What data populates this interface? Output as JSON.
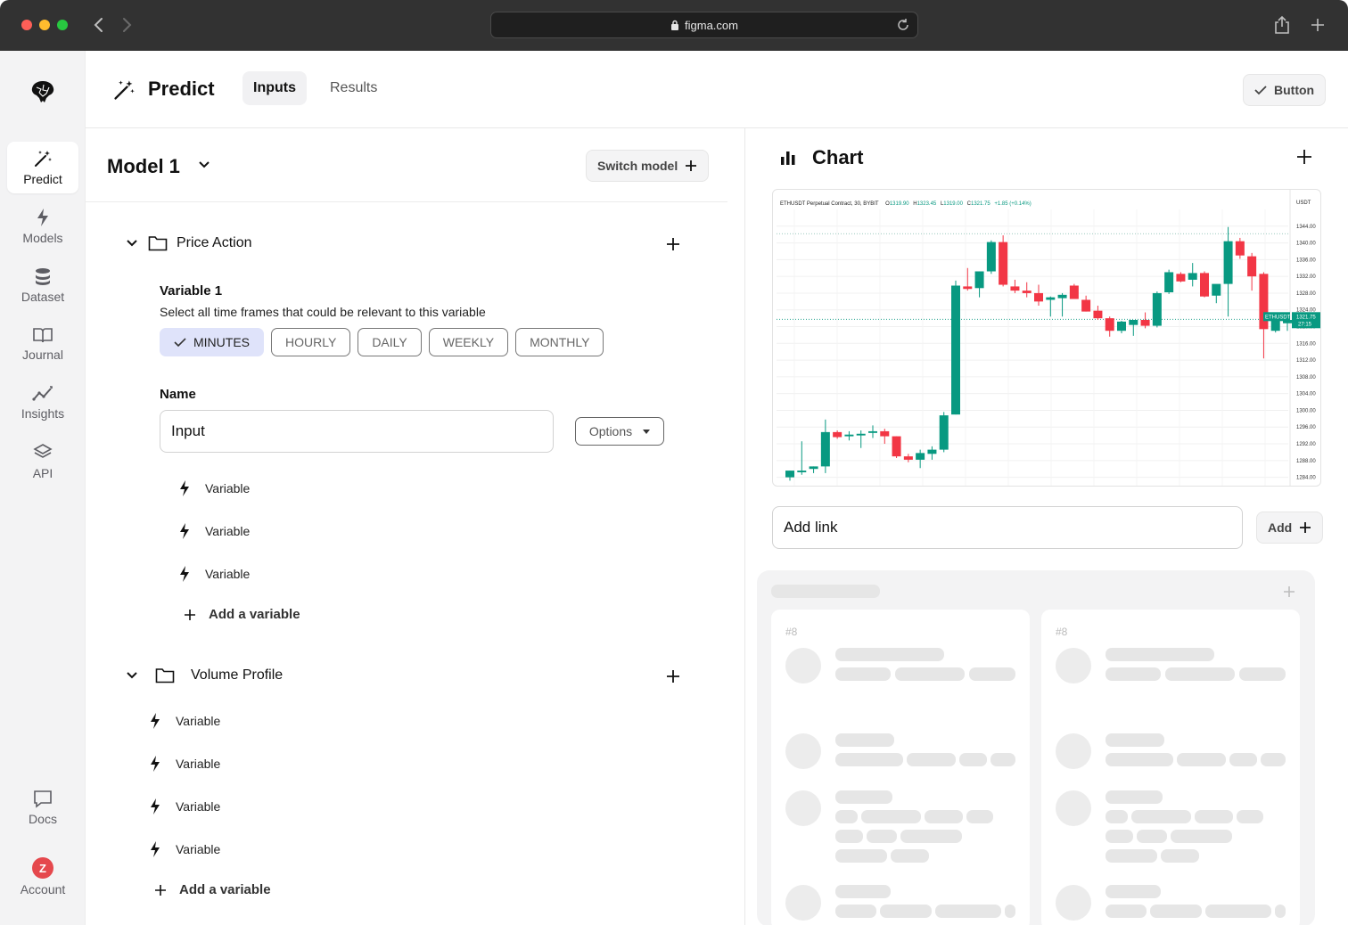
{
  "browser": {
    "url": "figma.com"
  },
  "sidebar": {
    "items": [
      {
        "label": "Predict",
        "icon": "magic-wand-icon",
        "active": true
      },
      {
        "label": "Models",
        "icon": "bolt-icon"
      },
      {
        "label": "Dataset",
        "icon": "database-icon"
      },
      {
        "label": "Journal",
        "icon": "book-icon"
      },
      {
        "label": "Insights",
        "icon": "trend-icon"
      },
      {
        "label": "API",
        "icon": "layers-icon"
      }
    ],
    "bottom": [
      {
        "label": "Docs",
        "icon": "chat-icon"
      },
      {
        "label": "Account",
        "avatar": "Z"
      }
    ]
  },
  "header": {
    "title": "Predict",
    "tabs": [
      {
        "label": "Inputs",
        "active": true
      },
      {
        "label": "Results"
      }
    ],
    "button": "Button"
  },
  "model": {
    "title": "Model 1",
    "switch_label": "Switch model",
    "sections": [
      {
        "title": "Price Action",
        "variable_title": "Variable 1",
        "variable_desc": "Select all time frames that could be relevant to this variable",
        "timeframes": [
          {
            "label": "MINUTES",
            "selected": true
          },
          {
            "label": "HOURLY"
          },
          {
            "label": "DAILY"
          },
          {
            "label": "WEEKLY"
          },
          {
            "label": "MONTHLY"
          }
        ],
        "name_label": "Name",
        "name_value": "Input",
        "options_label": "Options",
        "variables": [
          "Variable",
          "Variable",
          "Variable"
        ],
        "add_label": "Add a variable"
      },
      {
        "title": "Volume Profile",
        "variables": [
          "Variable",
          "Variable",
          "Variable",
          "Variable"
        ],
        "add_label": "Add a variable"
      }
    ]
  },
  "chart_panel": {
    "title": "Chart",
    "link_placeholder": "Add link",
    "add_label": "Add",
    "cards": [
      {
        "number": "#8"
      },
      {
        "number": "#8"
      }
    ]
  },
  "chart_data": {
    "type": "candlestick",
    "title": "ETHUSDT Perpetual Contract, 30, BYBIT",
    "ohlc_readout": {
      "O": "1319.90",
      "H": "1323.45",
      "L": "1319.00",
      "C": "1321.75",
      "change": "+1.85 (+0.14%)"
    },
    "currency": "USDT",
    "ylim": [
      1282,
      1348
    ],
    "y_ticks": [
      1344,
      1340,
      1336,
      1332,
      1328,
      1324,
      1320,
      1316,
      1312,
      1308,
      1304,
      1300,
      1296,
      1292,
      1288,
      1284
    ],
    "price_tag": {
      "symbol": "ETHUSDT",
      "price": "1321.75",
      "time": "27:15"
    },
    "colors": {
      "up": "#089981",
      "down": "#f23645"
    },
    "candles": [
      {
        "o": 1284.0,
        "h": 1285.6,
        "l": 1283.2,
        "c": 1285.6
      },
      {
        "o": 1285.2,
        "h": 1292.6,
        "l": 1284.6,
        "c": 1285.6
      },
      {
        "o": 1286.0,
        "h": 1286.6,
        "l": 1285.0,
        "c": 1286.6
      },
      {
        "o": 1286.6,
        "h": 1297.8,
        "l": 1285.0,
        "c": 1294.8
      },
      {
        "o": 1294.8,
        "h": 1295.2,
        "l": 1293.2,
        "c": 1293.6
      },
      {
        "o": 1293.8,
        "h": 1295.0,
        "l": 1292.8,
        "c": 1294.2
      },
      {
        "o": 1294.0,
        "h": 1295.2,
        "l": 1291.0,
        "c": 1294.4
      },
      {
        "o": 1294.6,
        "h": 1296.4,
        "l": 1293.4,
        "c": 1295.0
      },
      {
        "o": 1295.0,
        "h": 1295.6,
        "l": 1292.0,
        "c": 1293.8
      },
      {
        "o": 1293.8,
        "h": 1293.8,
        "l": 1288.6,
        "c": 1289.0
      },
      {
        "o": 1289.0,
        "h": 1289.6,
        "l": 1287.6,
        "c": 1288.2
      },
      {
        "o": 1288.2,
        "h": 1290.6,
        "l": 1286.2,
        "c": 1289.8
      },
      {
        "o": 1289.6,
        "h": 1291.4,
        "l": 1288.2,
        "c": 1290.6
      },
      {
        "o": 1290.6,
        "h": 1299.6,
        "l": 1290.0,
        "c": 1298.8
      },
      {
        "o": 1299.0,
        "h": 1331.0,
        "l": 1299.0,
        "c": 1329.8
      },
      {
        "o": 1329.6,
        "h": 1334.0,
        "l": 1328.6,
        "c": 1329.0
      },
      {
        "o": 1329.2,
        "h": 1333.2,
        "l": 1327.0,
        "c": 1333.2
      },
      {
        "o": 1333.2,
        "h": 1340.6,
        "l": 1332.6,
        "c": 1340.2
      },
      {
        "o": 1340.2,
        "h": 1341.8,
        "l": 1329.6,
        "c": 1330.0
      },
      {
        "o": 1329.6,
        "h": 1331.2,
        "l": 1328.0,
        "c": 1328.6
      },
      {
        "o": 1328.6,
        "h": 1330.6,
        "l": 1327.0,
        "c": 1328.0
      },
      {
        "o": 1328.0,
        "h": 1330.0,
        "l": 1325.0,
        "c": 1326.0
      },
      {
        "o": 1326.4,
        "h": 1327.2,
        "l": 1322.4,
        "c": 1327.0
      },
      {
        "o": 1326.8,
        "h": 1328.0,
        "l": 1322.4,
        "c": 1327.6
      },
      {
        "o": 1329.8,
        "h": 1330.2,
        "l": 1326.6,
        "c": 1326.6
      },
      {
        "o": 1326.4,
        "h": 1327.4,
        "l": 1323.6,
        "c": 1323.6
      },
      {
        "o": 1323.8,
        "h": 1325.0,
        "l": 1321.6,
        "c": 1322.0
      },
      {
        "o": 1322.0,
        "h": 1322.4,
        "l": 1317.6,
        "c": 1319.0
      },
      {
        "o": 1319.0,
        "h": 1321.4,
        "l": 1318.4,
        "c": 1321.2
      },
      {
        "o": 1320.4,
        "h": 1321.6,
        "l": 1317.8,
        "c": 1321.6
      },
      {
        "o": 1321.6,
        "h": 1323.4,
        "l": 1319.6,
        "c": 1320.2
      },
      {
        "o": 1320.2,
        "h": 1328.4,
        "l": 1319.8,
        "c": 1328.0
      },
      {
        "o": 1328.2,
        "h": 1333.6,
        "l": 1327.8,
        "c": 1333.0
      },
      {
        "o": 1332.6,
        "h": 1333.0,
        "l": 1330.6,
        "c": 1330.8
      },
      {
        "o": 1331.2,
        "h": 1335.2,
        "l": 1329.6,
        "c": 1332.8
      },
      {
        "o": 1332.8,
        "h": 1333.2,
        "l": 1327.0,
        "c": 1327.2
      },
      {
        "o": 1327.4,
        "h": 1328.0,
        "l": 1325.6,
        "c": 1330.2
      },
      {
        "o": 1330.2,
        "h": 1343.8,
        "l": 1322.4,
        "c": 1340.4
      },
      {
        "o": 1340.4,
        "h": 1341.2,
        "l": 1336.2,
        "c": 1337.0
      },
      {
        "o": 1336.8,
        "h": 1337.6,
        "l": 1328.6,
        "c": 1332.0
      },
      {
        "o": 1332.6,
        "h": 1333.0,
        "l": 1312.4,
        "c": 1319.4
      },
      {
        "o": 1319.0,
        "h": 1322.6,
        "l": 1318.6,
        "c": 1321.6
      },
      {
        "o": 1320.8,
        "h": 1321.6,
        "l": 1319.0,
        "c": 1321.6
      }
    ]
  }
}
